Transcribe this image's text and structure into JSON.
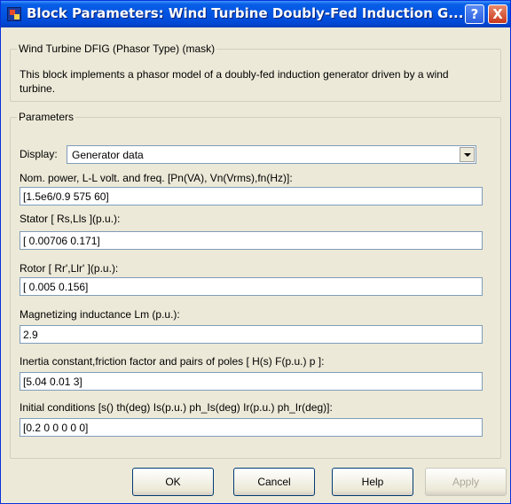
{
  "window": {
    "title": "Block Parameters: Wind Turbine Doubly-Fed Induction G...",
    "help_glyph": "?",
    "close_glyph": "X"
  },
  "mask": {
    "legend": "Wind Turbine DFIG (Phasor Type) (mask)",
    "description": "This block implements a phasor model of a doubly-fed induction generator driven by a wind turbine."
  },
  "parameters": {
    "legend": "Parameters",
    "display_label": "Display:",
    "display_value": "Generator data",
    "fields": [
      {
        "label": "Nom. power, L-L volt. and freq. [Pn(VA), Vn(Vrms),fn(Hz)]:",
        "value": "[1.5e6/0.9 575 60]"
      },
      {
        "label": "Stator [ Rs,Lls ](p.u.):",
        "value": "[ 0.00706 0.171]"
      },
      {
        "label": "Rotor [ Rr',Llr' ](p.u.):",
        "value": "[ 0.005 0.156]"
      },
      {
        "label": "Magnetizing inductance Lm (p.u.):",
        "value": "2.9"
      },
      {
        "label": "Inertia constant,friction factor and pairs of poles [ H(s) F(p.u.) p ]:",
        "value": "[5.04 0.01 3]"
      },
      {
        "label": "Initial conditions [s() th(deg) Is(p.u.) ph_Is(deg) Ir(p.u.) ph_Ir(deg)]:",
        "value": "[0.2 0 0 0 0 0]"
      }
    ]
  },
  "buttons": {
    "ok": "OK",
    "cancel": "Cancel",
    "help": "Help",
    "apply": "Apply"
  },
  "colors": {
    "title_bar": "#0054e3",
    "dialog_bg": "#ece9d8",
    "field_border": "#7f9db9"
  }
}
